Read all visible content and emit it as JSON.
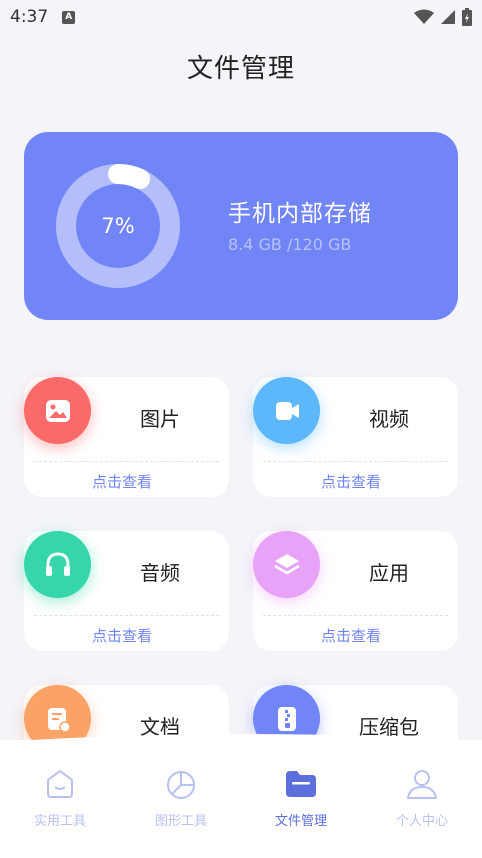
{
  "status": {
    "time": "4:37",
    "a_badge": "A"
  },
  "header": {
    "title": "文件管理"
  },
  "storage": {
    "percent_label": "7%",
    "percent": 0.07,
    "title": "手机内部存储",
    "size": "8.4 GB /120 GB"
  },
  "categories": [
    {
      "name": "图片",
      "action": "点击查看",
      "color": "#fb6a6a",
      "icon": "image-icon"
    },
    {
      "name": "视频",
      "action": "点击查看",
      "color": "#5cb8fb",
      "icon": "video-camera-icon"
    },
    {
      "name": "音频",
      "action": "点击查看",
      "color": "#35d6a9",
      "icon": "headphones-icon"
    },
    {
      "name": "应用",
      "action": "点击查看",
      "color": "#e8a2f7",
      "icon": "layers-icon"
    },
    {
      "name": "文档",
      "action": "",
      "color": "#fba267",
      "icon": "document-edit-icon"
    },
    {
      "name": "压缩包",
      "action": "",
      "color": "#7185f7",
      "icon": "zip-file-icon"
    }
  ],
  "tabs": [
    {
      "label": "实用工具",
      "icon": "home-icon",
      "active": false
    },
    {
      "label": "图形工具",
      "icon": "pie-chart-icon",
      "active": false
    },
    {
      "label": "文件管理",
      "icon": "folder-icon",
      "active": true
    },
    {
      "label": "个人中心",
      "icon": "user-icon",
      "active": false
    }
  ],
  "colors": {
    "accent": "#7185f7",
    "active_tab": "#5d6fdc",
    "inactive_tab": "#b9c1f2"
  }
}
